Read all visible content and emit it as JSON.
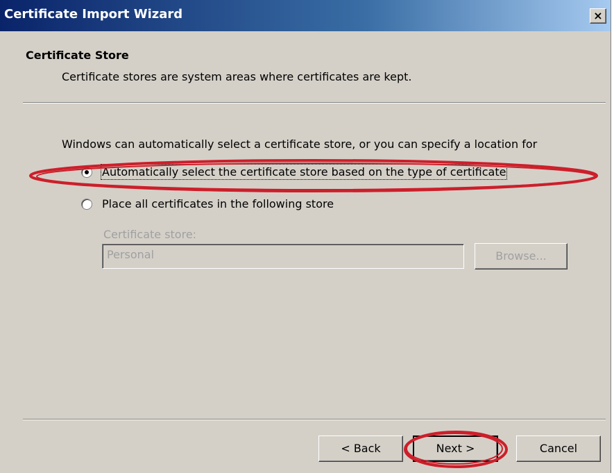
{
  "window": {
    "title": "Certificate Import Wizard",
    "close_label": "×"
  },
  "header": {
    "heading": "Certificate Store",
    "subtext": "Certificate stores are system areas where certificates are kept."
  },
  "body": {
    "intro": "Windows can automatically select a certificate store, or you can specify a location for",
    "options": [
      {
        "label": "Automatically select the certificate store based on the type of certificate",
        "selected": true
      },
      {
        "label": "Place all certificates in the following store",
        "selected": false
      }
    ],
    "store_label": "Certificate store:",
    "store_value": "Personal",
    "browse_label": "Browse..."
  },
  "footer": {
    "back_label": "< Back",
    "next_label": "Next >",
    "cancel_label": "Cancel"
  },
  "annotation_color": "#cc1f2a"
}
